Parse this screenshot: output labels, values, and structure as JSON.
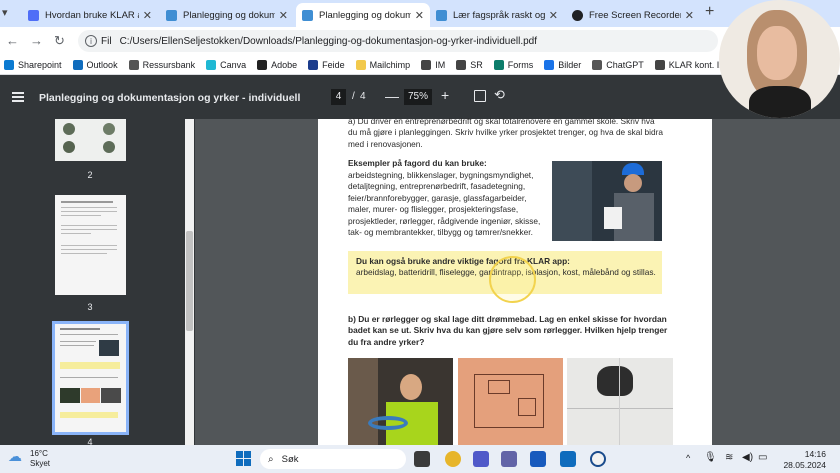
{
  "browser": {
    "tabs": [
      {
        "title": "Hvordan bruke KLAR app",
        "active": false,
        "favicon_color": "#4f6ef7"
      },
      {
        "title": "Planlegging og dokumen",
        "active": false,
        "favicon_color": "#3f8ed3"
      },
      {
        "title": "Planlegging og dokumen",
        "active": true,
        "favicon_color": "#3f8ed3"
      },
      {
        "title": "Lær fagspråk raskt og en",
        "active": false,
        "favicon_color": "#3f8ed3"
      },
      {
        "title": "Free Screen Recorder fo",
        "active": false,
        "favicon_color": "#202124"
      }
    ],
    "new_tab_label": "+",
    "address": {
      "scheme_label": "Fil",
      "url": "C:/Users/EllenSeljestokken/Downloads/Planlegging-og-dokumentasjon-og-yrker-individuell.pdf"
    },
    "bookmarks": [
      {
        "label": "Sharepoint",
        "color": "#0b7ad1"
      },
      {
        "label": "Outlook",
        "color": "#0f6cbd"
      },
      {
        "label": "Ressursbank",
        "color": "#555555"
      },
      {
        "label": "Canva",
        "color": "#1fb8d3"
      },
      {
        "label": "Adobe",
        "color": "#222222"
      },
      {
        "label": "Feide",
        "color": "#1b3c8c"
      },
      {
        "label": "Mailchimp",
        "color": "#f2c94c"
      },
      {
        "label": "IM",
        "color": "#444444"
      },
      {
        "label": "SR",
        "color": "#444444"
      },
      {
        "label": "Forms",
        "color": "#0c7d6b"
      },
      {
        "label": "Bilder",
        "color": "#1a73e8"
      },
      {
        "label": "ChatGPT",
        "color": "#555555"
      },
      {
        "label": "KLAR kont. Innl",
        "color": "#444444"
      },
      {
        "label": "KLA",
        "color": "#444444"
      }
    ]
  },
  "pdf_viewer": {
    "title": "Planlegging og dokumentasjon og yrker - individuell",
    "current_page": "4",
    "page_separator": "/",
    "total_pages": "4",
    "zoom": "75%",
    "zoom_out": "—",
    "zoom_in": "+",
    "thumbnails": [
      {
        "label": "2"
      },
      {
        "label": "3"
      },
      {
        "label": "4",
        "selected": true
      }
    ]
  },
  "document": {
    "task_a": "a) Du driver en entreprenørbedrift og skal totalrenovere en gammel skole. Skriv hva du må gjøre i planleggingen. Skriv hvilke yrker prosjektet trenger, og hva de skal bidra med i renovasjonen.",
    "examples_heading": "Eksempler på fagord du kan bruke:",
    "examples_body": "arbeidstegning, blikkenslager, bygningsmyndighet, detaljtegning, entreprenørbedrift, fasadetegning, feier/brannforebygger, garasje, glassfagarbeider, maler, murer- og flislegger, prosjekteringsfase, prosjektleder, rørlegger, rådgivende ingeniør, skisse, tak- og membrantekker, tilbygg og tømrer/snekker.",
    "klar_heading": "Du kan også bruke andre viktige fagord fra KLAR app:",
    "klar_body": "arbeidslag, batteridrill, fliselegge, gardintrapp, isolasjon, kost, målebånd og stillas.",
    "task_b": "b) Du er rørlegger og skal lage ditt drømmebad. Lag en enkel skisse for hvordan badet kan se ut. Skriv hva du kan gjøre selv som rørlegger. Hvilken hjelp trenger du fra andre yrker?"
  },
  "taskbar": {
    "weather_temp": "16°C",
    "weather_desc": "Skyet",
    "search_placeholder": "Søk",
    "time": "14:16",
    "date": "28.05.2024"
  }
}
